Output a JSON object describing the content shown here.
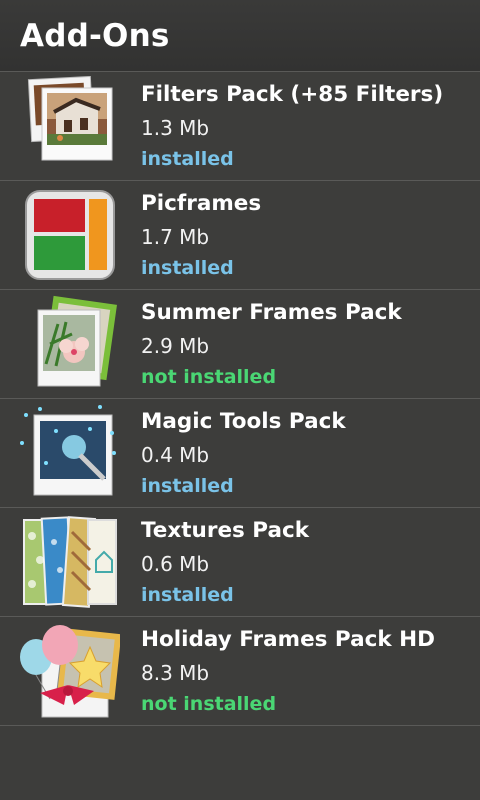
{
  "header": {
    "title": "Add-Ons"
  },
  "colors": {
    "installed": "#7ac3e8",
    "not_installed": "#4ad774",
    "background": "#3d3d3b"
  },
  "items": [
    {
      "name": "Filters Pack (+85 Filters)",
      "size": "1.3 Mb",
      "status": "installed",
      "icon": "filters-pack-icon"
    },
    {
      "name": "Picframes",
      "size": "1.7 Mb",
      "status": "installed",
      "icon": "picframes-icon"
    },
    {
      "name": "Summer Frames Pack",
      "size": "2.9 Mb",
      "status": "not installed",
      "icon": "summer-frames-icon"
    },
    {
      "name": "Magic Tools Pack",
      "size": "0.4 Mb",
      "status": "installed",
      "icon": "magic-tools-icon"
    },
    {
      "name": "Textures Pack",
      "size": "0.6 Mb",
      "status": "installed",
      "icon": "textures-pack-icon"
    },
    {
      "name": "Holiday Frames Pack HD",
      "size": "8.3 Mb",
      "status": "not installed",
      "icon": "holiday-frames-icon"
    }
  ]
}
